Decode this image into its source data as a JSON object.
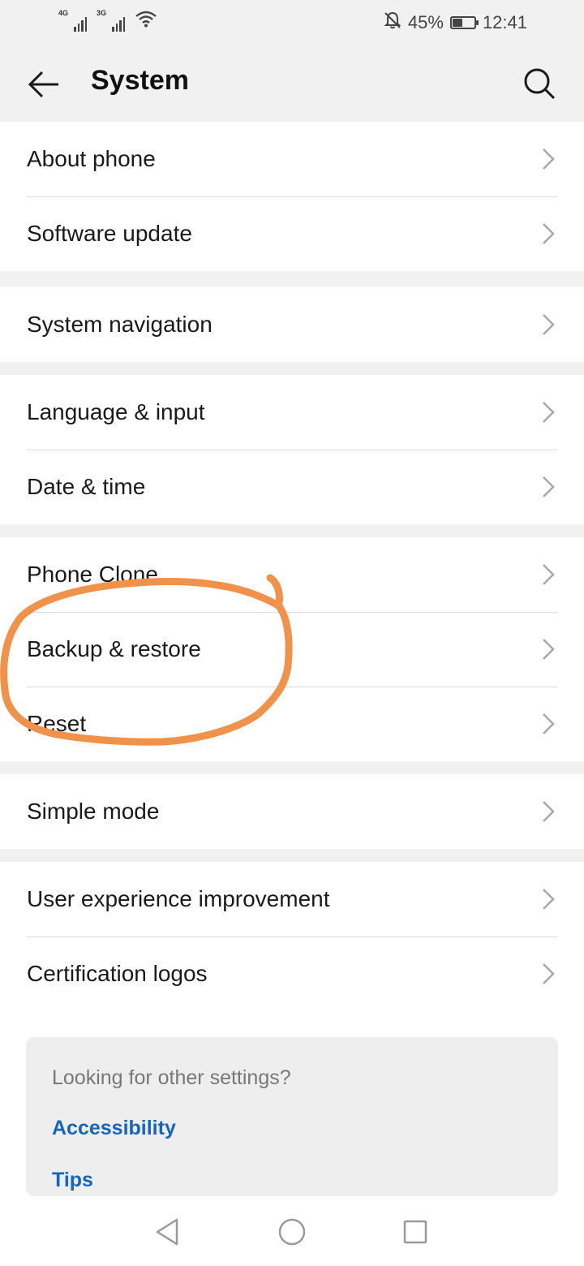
{
  "status_bar": {
    "network_1": "4G",
    "network_2": "3G",
    "battery_percent": "45%",
    "battery_level": 0.45,
    "time": "12:41",
    "icons": [
      "signal-icon",
      "signal-icon",
      "wifi-icon",
      "alarm-off-icon",
      "battery-icon"
    ]
  },
  "header": {
    "title": "System",
    "back_icon": "back-arrow-icon",
    "search_icon": "search-icon"
  },
  "settings_groups": [
    {
      "items": [
        {
          "label": "About phone"
        },
        {
          "label": "Software update"
        }
      ]
    },
    {
      "items": [
        {
          "label": "System navigation"
        }
      ]
    },
    {
      "items": [
        {
          "label": "Language & input"
        },
        {
          "label": "Date & time"
        }
      ]
    },
    {
      "items": [
        {
          "label": "Phone Clone"
        },
        {
          "label": "Backup & restore"
        },
        {
          "label": "Reset"
        }
      ]
    },
    {
      "items": [
        {
          "label": "Simple mode"
        }
      ]
    },
    {
      "items": [
        {
          "label": "User experience improvement"
        },
        {
          "label": "Certification logos"
        }
      ]
    }
  ],
  "suggestions": {
    "title": "Looking for other settings?",
    "links": [
      {
        "label": "Accessibility"
      },
      {
        "label": "Tips"
      }
    ]
  },
  "nav_bar": {
    "icons": [
      "nav-back-icon",
      "nav-home-icon",
      "nav-recents-icon"
    ]
  },
  "annotation": {
    "shape": "hand-drawn circle",
    "highlighted_item": "Backup & restore",
    "color": "#f0924a"
  },
  "colors": {
    "background": "#f1f1f1",
    "card": "#ffffff",
    "link": "#1565c0",
    "annotation": "#f0924a"
  }
}
